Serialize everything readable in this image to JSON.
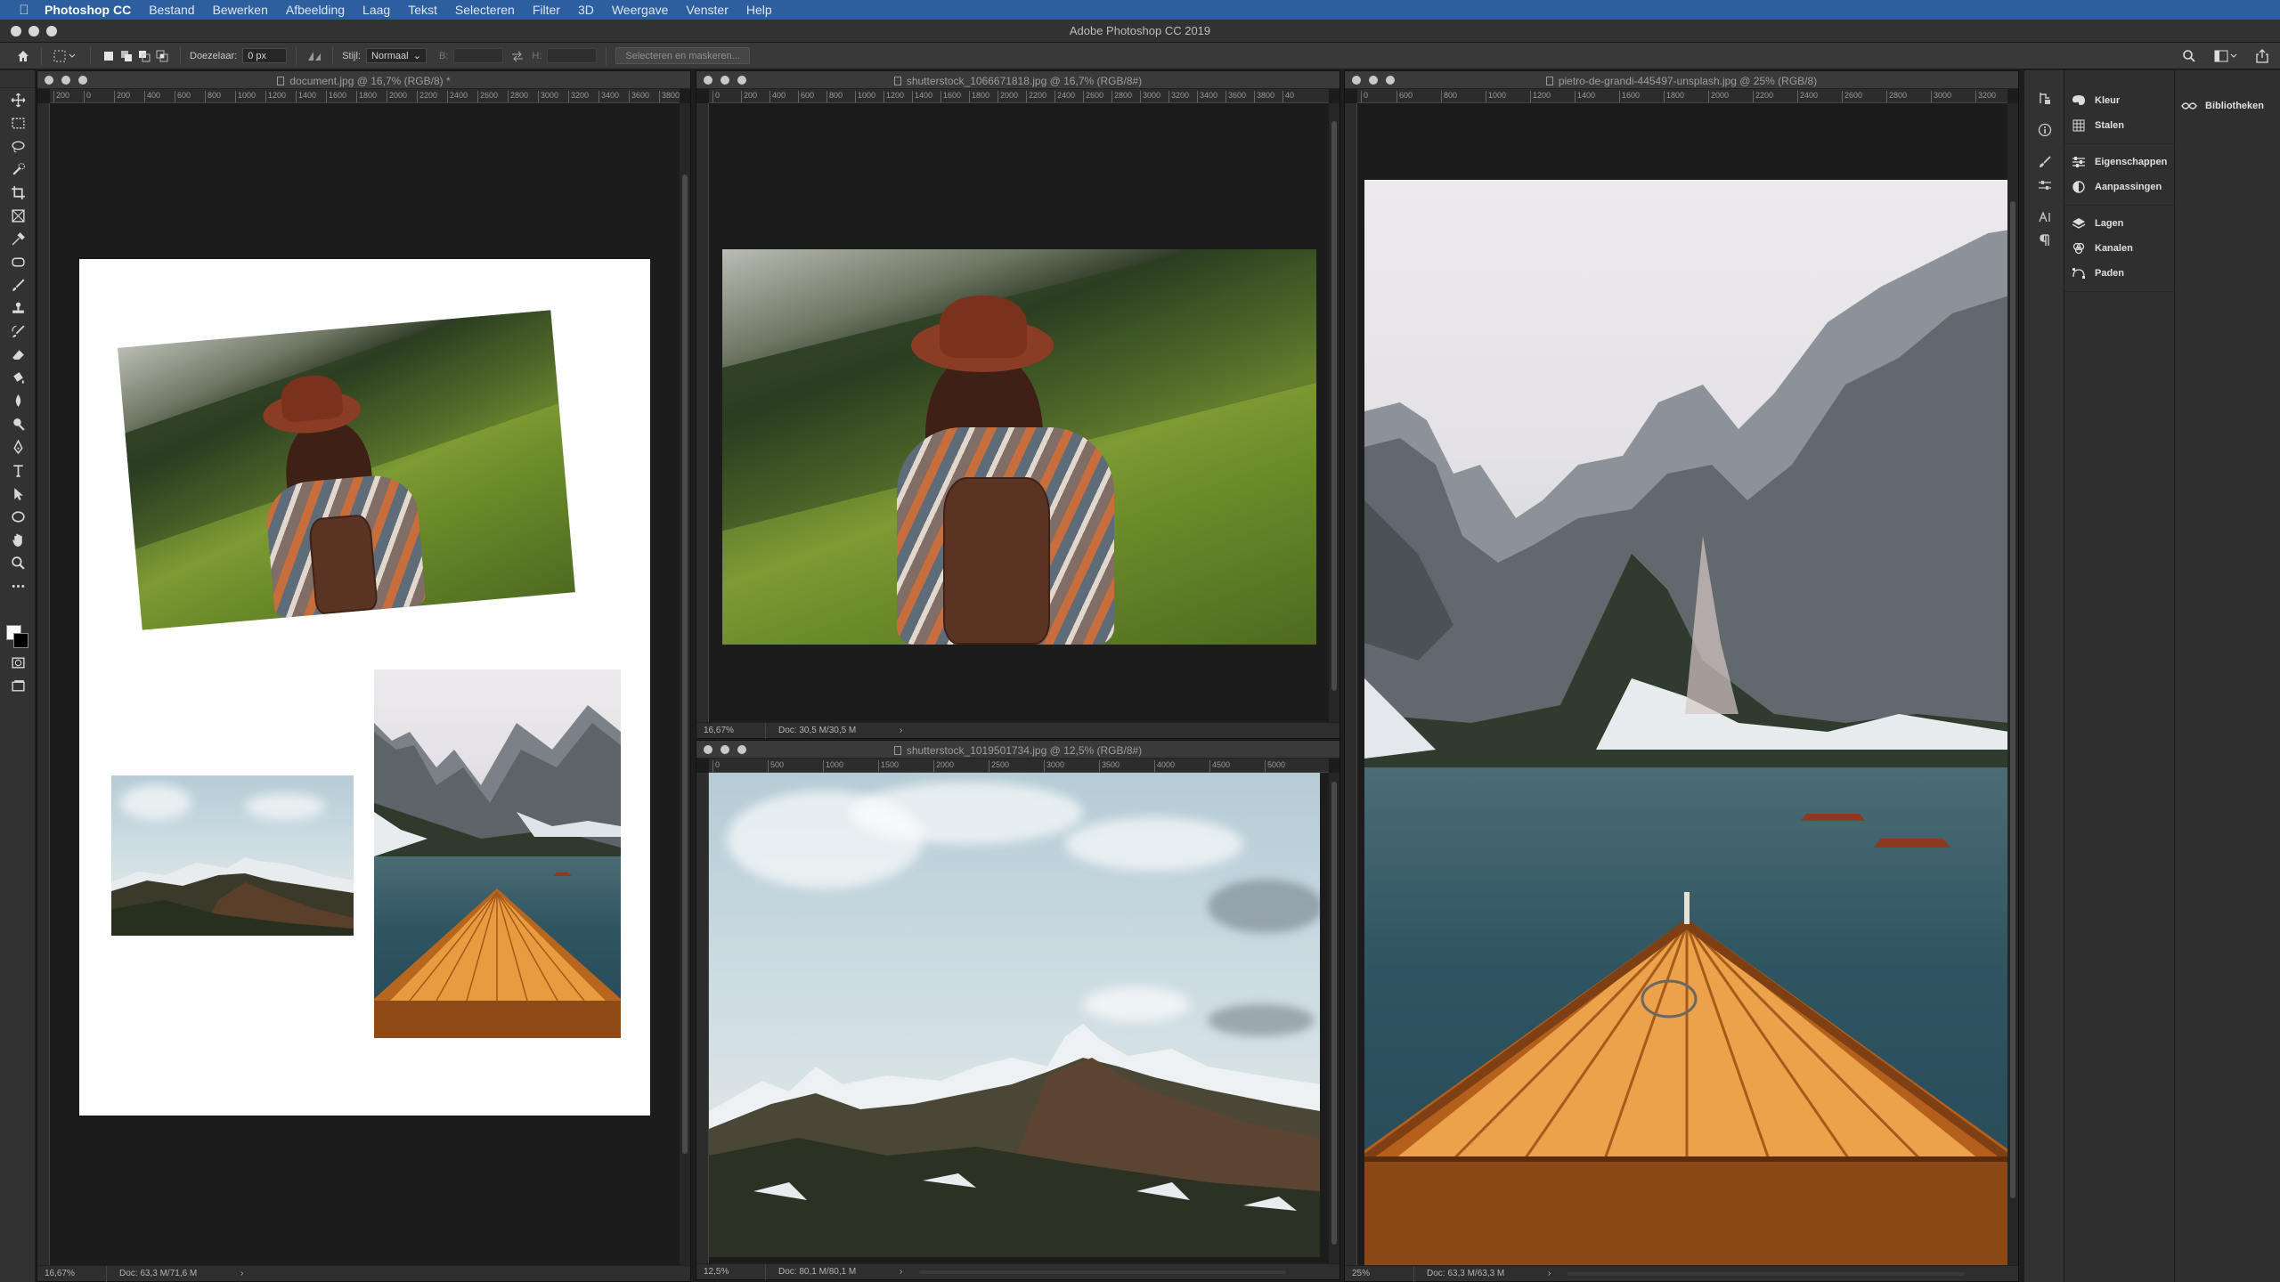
{
  "menubar": {
    "app": "Photoshop CC",
    "items": [
      "Bestand",
      "Bewerken",
      "Afbeelding",
      "Laag",
      "Tekst",
      "Selecteren",
      "Filter",
      "3D",
      "Weergave",
      "Venster",
      "Help"
    ]
  },
  "window": {
    "title": "Adobe Photoshop CC 2019"
  },
  "options": {
    "feather_label": "Doezelaar:",
    "feather_value": "0 px",
    "style_label": "Stijl:",
    "style_value": "Normaal",
    "width_label": "B:",
    "height_label": "H:",
    "select_mask_button": "Selecteren en maskeren..."
  },
  "documents": {
    "doc1": {
      "title": "document.jpg @ 16,7% (RGB/8) *",
      "zoom": "16,67%",
      "info": "Doc: 63,3 M/71,6 M",
      "ruler": [
        "200",
        "0",
        "200",
        "400",
        "600",
        "800",
        "1000",
        "1200",
        "1400",
        "1600",
        "1800",
        "2000",
        "2200",
        "2400",
        "2600",
        "2800",
        "3000",
        "3200",
        "3400",
        "3600",
        "3800"
      ]
    },
    "doc2": {
      "title": "shutterstock_1066671818.jpg @ 16,7% (RGB/8#)",
      "zoom": "16,67%",
      "info": "Doc: 30,5 M/30,5 M",
      "ruler": [
        "0",
        "200",
        "400",
        "600",
        "800",
        "1000",
        "1200",
        "1400",
        "1600",
        "1800",
        "2000",
        "2200",
        "2400",
        "2600",
        "2800",
        "3000",
        "3200",
        "3400",
        "3600",
        "3800",
        "40"
      ]
    },
    "doc3": {
      "title": "shutterstock_1019501734.jpg @ 12,5% (RGB/8#)",
      "zoom": "12,5%",
      "info": "Doc: 80,1 M/80,1 M",
      "ruler": [
        "0",
        "500",
        "1000",
        "1500",
        "2000",
        "2500",
        "3000",
        "3500",
        "4000",
        "4500",
        "5000"
      ]
    },
    "doc4": {
      "title": "pietro-de-grandi-445497-unsplash.jpg @ 25% (RGB/8)",
      "zoom": "25%",
      "info": "Doc: 63,3 M/63,3 M",
      "ruler": [
        "0",
        "600",
        "800",
        "1000",
        "1200",
        "1400",
        "1600",
        "1800",
        "2000",
        "2200",
        "2400",
        "2600",
        "2800",
        "3000",
        "3200"
      ]
    }
  },
  "panels": {
    "group1": [
      "Kleur",
      "Stalen"
    ],
    "group2": [
      "Eigenschappen",
      "Aanpassingen"
    ],
    "group3": [
      "Lagen",
      "Kanalen",
      "Paden"
    ],
    "libraries": "Bibliotheken"
  },
  "colors": {
    "menubar": "#2d5f9e",
    "panel": "#323232",
    "canvas_bg": "#1c1c1c",
    "foreground_swatch": "#ffffff",
    "background_swatch": "#000000"
  }
}
